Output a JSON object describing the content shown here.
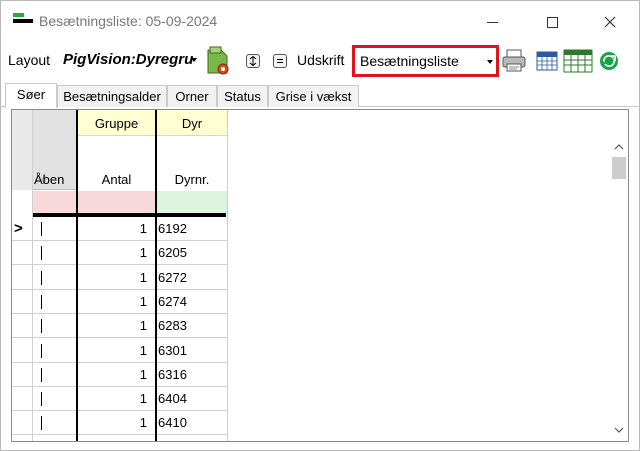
{
  "window": {
    "title": "Besætningsliste: 05-09-2024"
  },
  "toolbar": {
    "layout_label": "Layout",
    "layout_value": "PigVision:Dyregruppe",
    "print_label": "Udskrift",
    "report_value": "Besætningsliste",
    "highlight_color": "#e0141c"
  },
  "tabs": [
    {
      "label": "Søer",
      "active": true
    },
    {
      "label": "Besætningsalder",
      "active": false
    },
    {
      "label": "Orner",
      "active": false
    },
    {
      "label": "Status",
      "active": false
    },
    {
      "label": "Grise i vækst",
      "active": false
    }
  ],
  "grid": {
    "group_headers": {
      "gruppe": "Gruppe",
      "dyr": "Dyr"
    },
    "columns": {
      "aben": "Åben",
      "antal": "Antal",
      "dyrnr": "Dyrnr."
    },
    "current_row_marker": ">",
    "rows": [
      {
        "antal": "1",
        "dyrnr": "6192"
      },
      {
        "antal": "1",
        "dyrnr": "6205"
      },
      {
        "antal": "1",
        "dyrnr": "6272"
      },
      {
        "antal": "1",
        "dyrnr": "6274"
      },
      {
        "antal": "1",
        "dyrnr": "6283"
      },
      {
        "antal": "1",
        "dyrnr": "6301"
      },
      {
        "antal": "1",
        "dyrnr": "6316"
      },
      {
        "antal": "1",
        "dyrnr": "6404"
      },
      {
        "antal": "1",
        "dyrnr": "6410"
      }
    ]
  },
  "icons": {
    "layout_settings": "layout-settings-icon",
    "expand": "expand-icon",
    "collapse": "collapse-icon",
    "printer": "printer-icon",
    "calendar": "calendar-icon",
    "table": "table-grid-icon",
    "refresh": "refresh-icon"
  }
}
